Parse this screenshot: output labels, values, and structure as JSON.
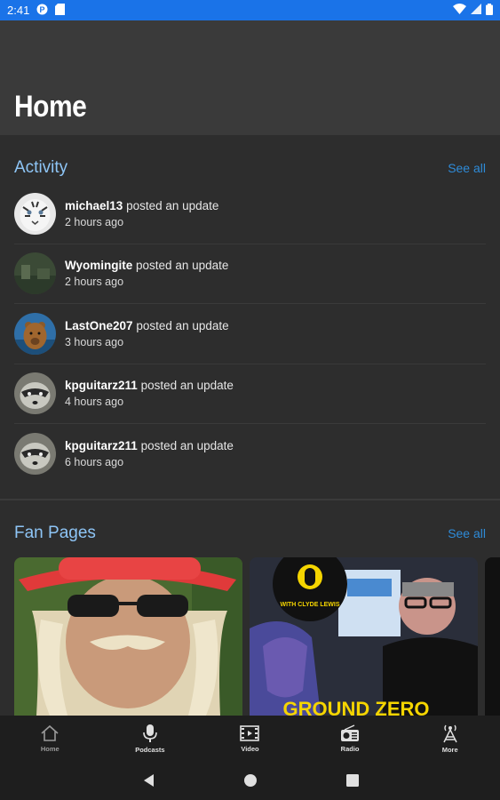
{
  "status_bar": {
    "time": "2:41"
  },
  "header": {
    "title": "Home"
  },
  "activity": {
    "title": "Activity",
    "see_all": "See all",
    "items": [
      {
        "user": "michael13",
        "action": "posted an update",
        "time": "2 hours ago",
        "avatar": "tiger-avatar"
      },
      {
        "user": "Wyomingite",
        "action": "posted an update",
        "time": "2 hours ago",
        "avatar": "landscape-avatar"
      },
      {
        "user": "LastOne207",
        "action": "posted an update",
        "time": "3 hours ago",
        "avatar": "bear-avatar"
      },
      {
        "user": "kpguitarz211",
        "action": "posted an update",
        "time": "4 hours ago",
        "avatar": "raccoon-avatar"
      },
      {
        "user": "kpguitarz211",
        "action": "posted an update",
        "time": "6 hours ago",
        "avatar": "raccoon-avatar"
      }
    ]
  },
  "fan_pages": {
    "title": "Fan Pages",
    "see_all": "See all",
    "cards": [
      {
        "name": "fan-page-card-1",
        "image": "man-red-hat-photo"
      },
      {
        "name": "fan-page-card-2",
        "image": "ground-zero-photo",
        "banner_text": "GROUND ZERO",
        "logo_text": "WITH CLYDE LEWIS"
      }
    ]
  },
  "bottom_nav": {
    "items": [
      {
        "label": "Home",
        "icon": "home-icon",
        "active": true
      },
      {
        "label": "Podcasts",
        "icon": "microphone-icon"
      },
      {
        "label": "Video",
        "icon": "film-icon"
      },
      {
        "label": "Radio",
        "icon": "radio-icon"
      },
      {
        "label": "More",
        "icon": "tower-icon"
      }
    ]
  },
  "colors": {
    "status_bar": "#1a73e8",
    "accent": "#2e8bd8",
    "section_title": "#8ec5f6",
    "background": "#2d2d2d"
  }
}
